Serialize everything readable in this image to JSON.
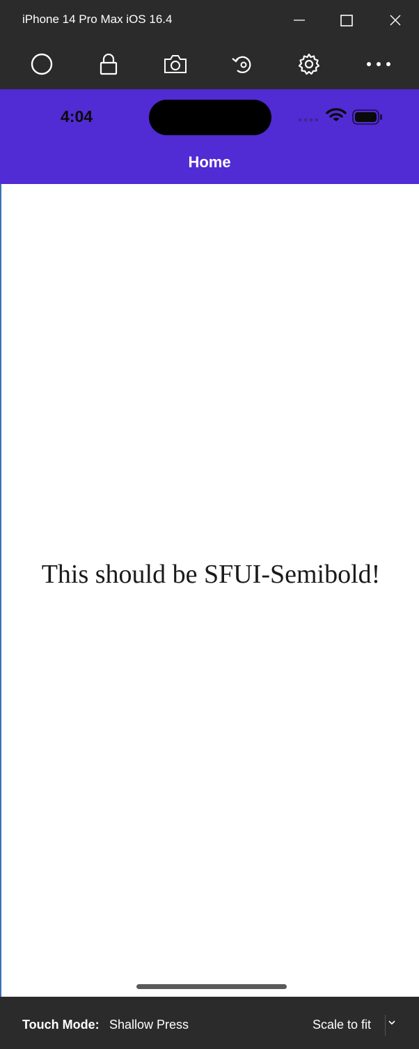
{
  "window": {
    "title": "iPhone 14 Pro Max iOS 16.4"
  },
  "toolbar": {
    "items": [
      "home-icon",
      "lock-icon",
      "camera-icon",
      "rotate-icon",
      "gear-icon",
      "more-icon"
    ]
  },
  "status_bar": {
    "time": "4:04"
  },
  "nav": {
    "title": "Home"
  },
  "main": {
    "message": "This should be SFUI-Semibold!"
  },
  "bottom_bar": {
    "touch_mode_label": "Touch Mode:",
    "touch_mode_value": "Shallow Press",
    "scale_value": "Scale to fit"
  },
  "colors": {
    "chrome": "#2b2b2b",
    "accent": "#512bd4",
    "content_bg": "#ffffff"
  }
}
